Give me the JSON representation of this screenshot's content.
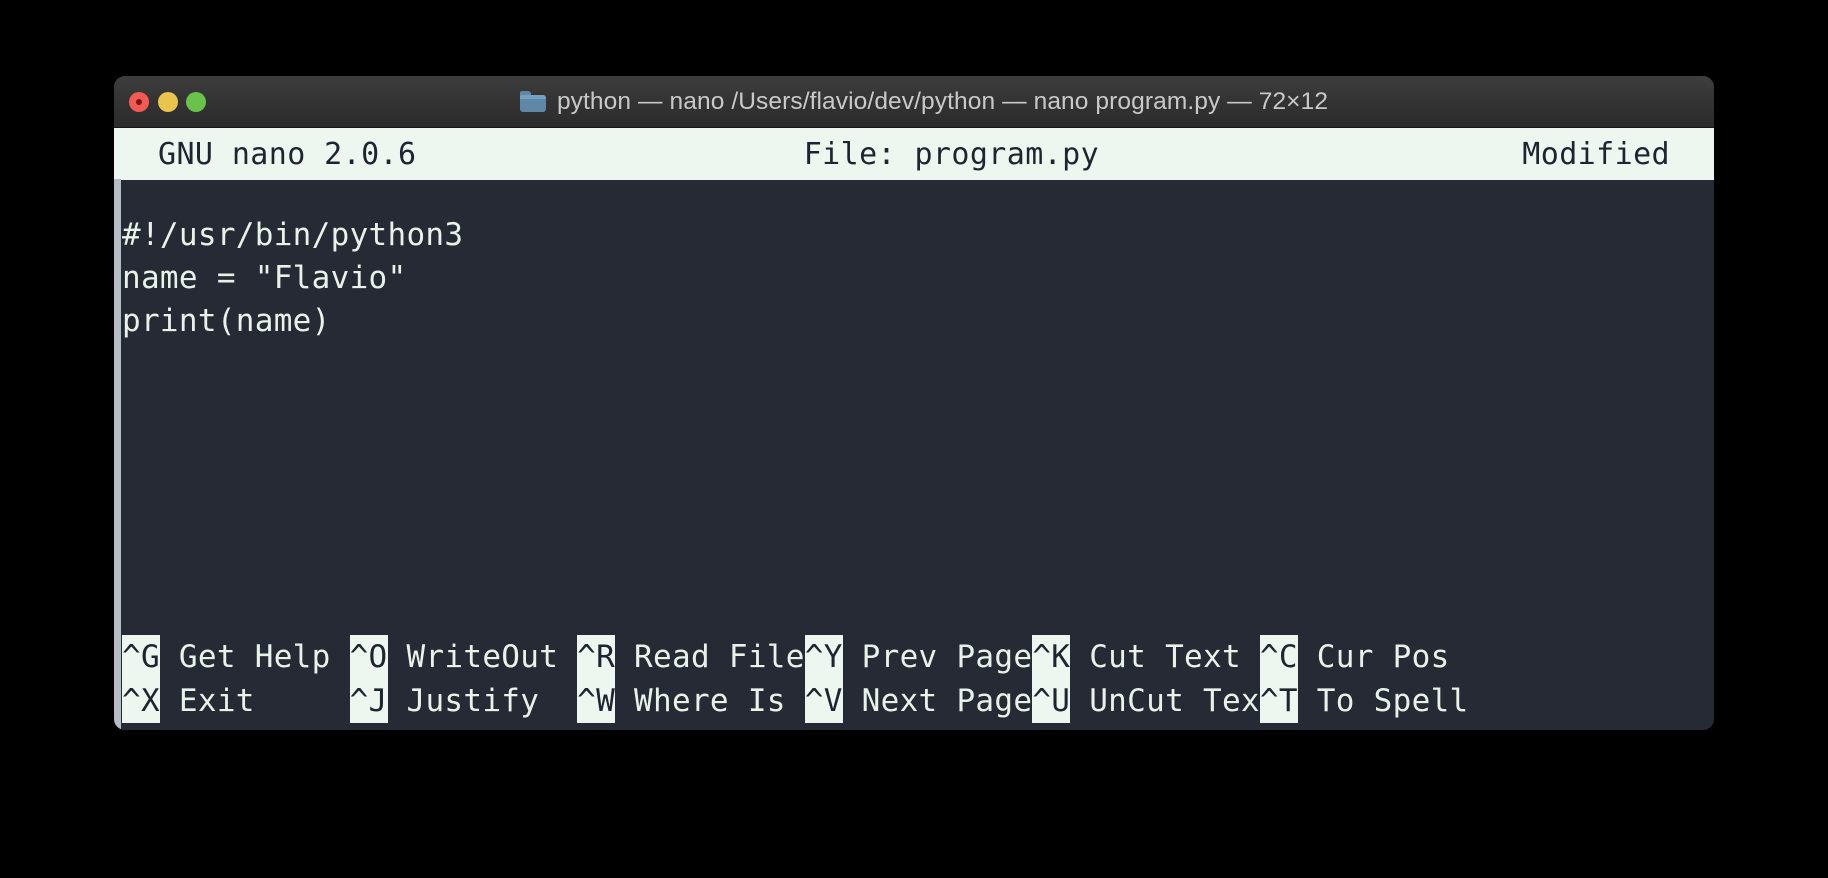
{
  "window": {
    "title": "python — nano /Users/flavio/dev/python — nano program.py — 72×12",
    "folder_icon": "folder-icon",
    "traffic_lights": [
      {
        "name": "close-button",
        "color": "#f25a55"
      },
      {
        "name": "minimize-button",
        "color": "#eac54d"
      },
      {
        "name": "zoom-button",
        "color": "#6bc24a"
      }
    ]
  },
  "nano": {
    "header": {
      "version": "GNU nano 2.0.6",
      "file": "File: program.py",
      "state": "Modified"
    },
    "code_lines": [
      "#!/usr/bin/python3",
      "name = \"Flavio\"",
      "print(name)"
    ],
    "shortcuts_row1": [
      {
        "key": "^G",
        "label": " Get Help "
      },
      {
        "key": "^O",
        "label": " WriteOut "
      },
      {
        "key": "^R",
        "label": " Read File"
      },
      {
        "key": "^Y",
        "label": " Prev Page"
      },
      {
        "key": "^K",
        "label": " Cut Text "
      },
      {
        "key": "^C",
        "label": " Cur Pos"
      }
    ],
    "shortcuts_row2": [
      {
        "key": "^X",
        "label": " Exit     "
      },
      {
        "key": "^J",
        "label": " Justify  "
      },
      {
        "key": "^W",
        "label": " Where Is "
      },
      {
        "key": "^V",
        "label": " Next Page"
      },
      {
        "key": "^U",
        "label": " UnCut Tex"
      },
      {
        "key": "^T",
        "label": " To Spell"
      }
    ]
  },
  "colors": {
    "terminal_background": "#252a35",
    "terminal_foreground": "#e8f2e8",
    "highlight_background": "#eef7ef",
    "highlight_foreground": "#1f2430",
    "titlebar": "#323232",
    "desktop": "#000000"
  }
}
